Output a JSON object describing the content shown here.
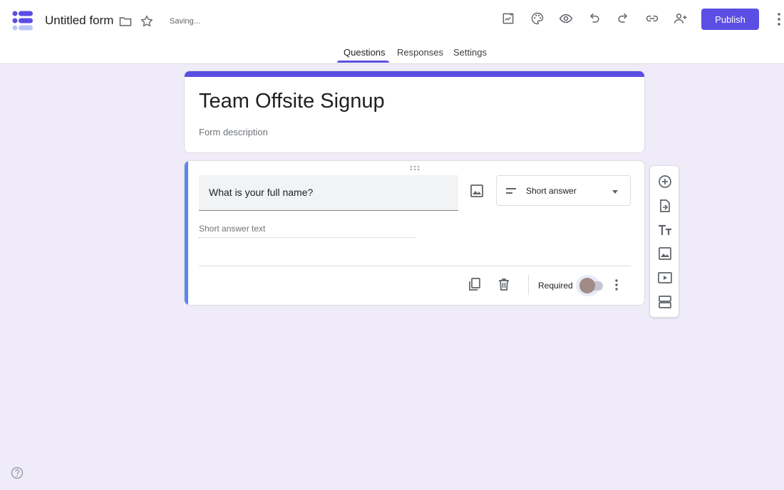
{
  "header": {
    "doc_title": "Untitled form",
    "status": "Saving...",
    "publish_label": "Publish",
    "icons": [
      "folder-icon",
      "star-icon",
      "customize-icon",
      "palette-icon",
      "preview-icon",
      "undo-icon",
      "redo-icon",
      "link-icon",
      "add-collaborator-icon",
      "more-vert-icon"
    ]
  },
  "tabs": [
    {
      "label": "Questions",
      "active": true
    },
    {
      "label": "Responses",
      "active": false
    },
    {
      "label": "Settings",
      "active": false
    }
  ],
  "form": {
    "title": "Team Offsite Signup",
    "description_placeholder": "Form description"
  },
  "question": {
    "text": "What is your full name?",
    "type_label": "Short answer",
    "answer_placeholder": "Short answer text",
    "required_label": "Required",
    "required_on": false
  },
  "side_toolbar": [
    "add-question-icon",
    "import-questions-icon",
    "add-title-icon",
    "add-image-icon",
    "add-video-icon",
    "add-section-icon"
  ],
  "colors": {
    "accent": "#5b4ee3",
    "question_accent": "#5b87f0",
    "background": "#f0ebf8"
  }
}
